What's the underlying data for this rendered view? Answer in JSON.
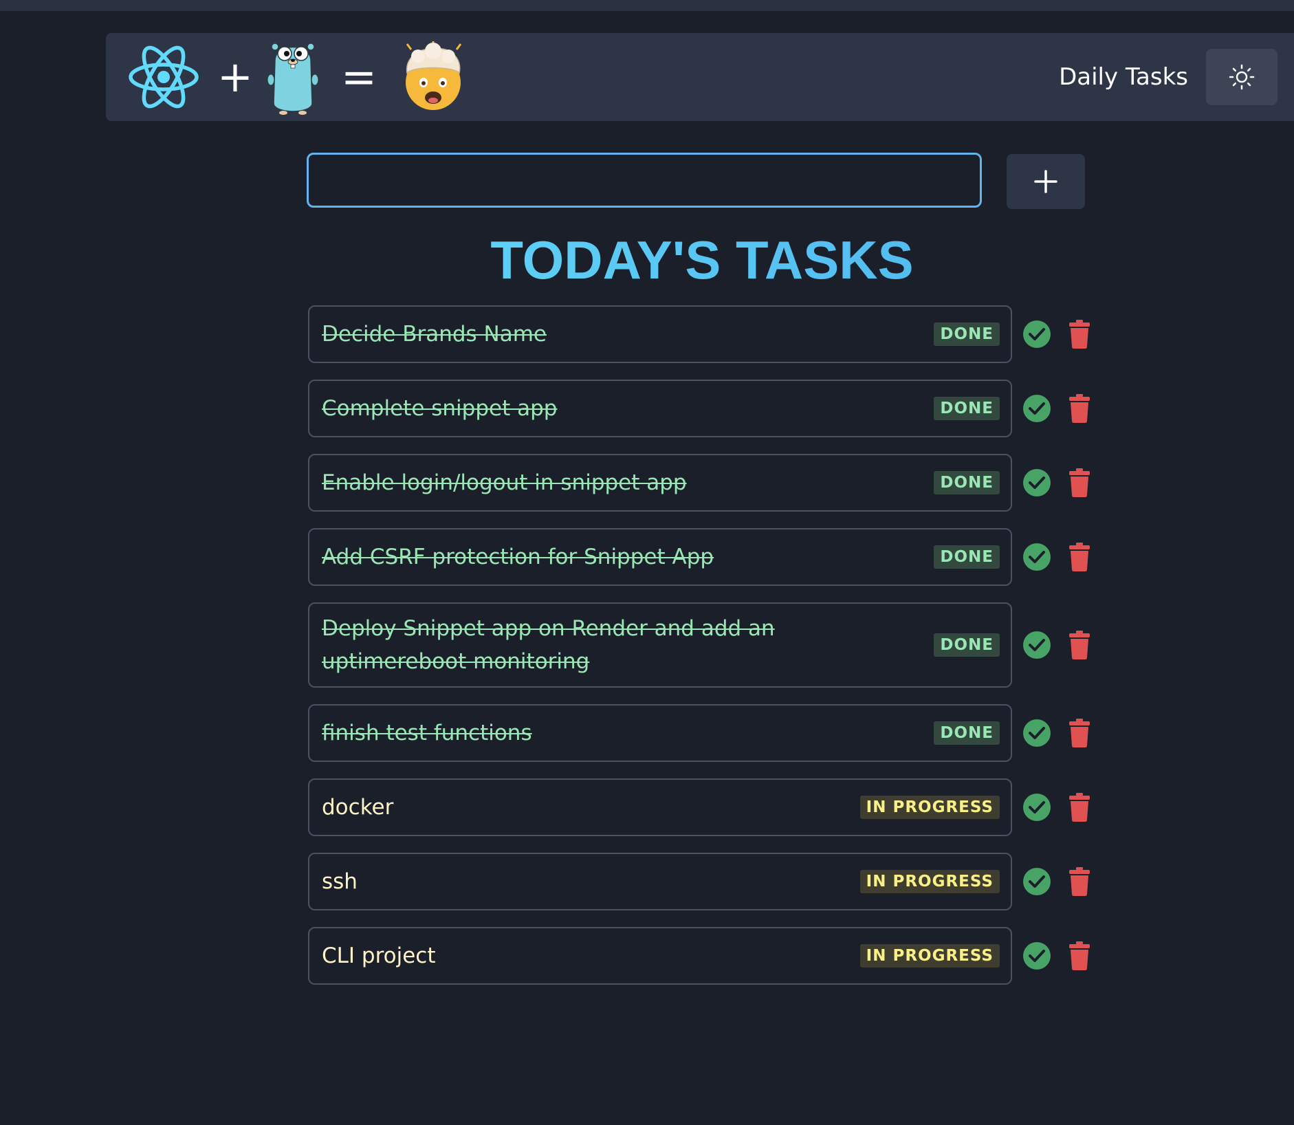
{
  "header": {
    "brand_title": "Daily Tasks",
    "logo_equation": {
      "plus": "+",
      "equals": "=",
      "icons": [
        "react-logo-icon",
        "go-gopher-icon",
        "mind-blown-emoji-icon"
      ],
      "emoji": "🤯"
    },
    "theme_toggle_icon": "sun-icon"
  },
  "add_task": {
    "input_value": "",
    "input_placeholder": "",
    "button_icon": "plus-icon"
  },
  "page": {
    "title": "TODAY'S TASKS"
  },
  "colors": {
    "background": "#1b1f2a",
    "navbar": "#2d3546",
    "accent_blue": "#63b3ed",
    "title_cyan": "#4fc8f5",
    "done_green": "#9ae6b4",
    "progress_yellow": "#faf089",
    "complete_button": "#48a366",
    "delete_red": "#e05252"
  },
  "tasks": [
    {
      "text": "Decide Brands Name",
      "status": "DONE"
    },
    {
      "text": "Complete snippet app",
      "status": "DONE"
    },
    {
      "text": "Enable login/logout in snippet app",
      "status": "DONE"
    },
    {
      "text": "Add CSRF protection for Snippet App",
      "status": "DONE"
    },
    {
      "text": "Deploy Snippet app on Render and add an uptimereboot monitoring",
      "status": "DONE"
    },
    {
      "text": "finish test functions",
      "status": "DONE"
    },
    {
      "text": "docker",
      "status": "IN PROGRESS"
    },
    {
      "text": "ssh",
      "status": "IN PROGRESS"
    },
    {
      "text": "CLI project",
      "status": "IN PROGRESS"
    }
  ],
  "row_icons": {
    "complete": "check-circle-icon",
    "delete": "trash-icon"
  }
}
